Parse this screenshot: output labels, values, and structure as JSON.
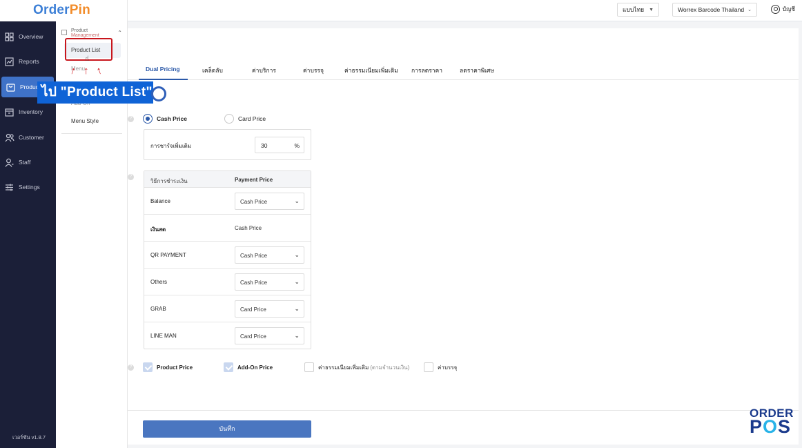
{
  "app": {
    "logo_part1": "Order",
    "logo_part2": "Pin",
    "version": "เวอร์ชัน v1.8.7"
  },
  "header": {
    "language": "แบบไทย",
    "store": "Worrex Barcode Thailand",
    "account": "บัญชี"
  },
  "sidebar": {
    "items": [
      {
        "label": "Overview",
        "icon": "grid-icon"
      },
      {
        "label": "Reports",
        "icon": "chart-icon"
      },
      {
        "label": "Product",
        "icon": "bag-icon",
        "active": true
      },
      {
        "label": "Inventory",
        "icon": "box-icon"
      },
      {
        "label": "Customer",
        "icon": "users-icon"
      },
      {
        "label": "Staff",
        "icon": "person-icon"
      },
      {
        "label": "Settings",
        "icon": "sliders-icon"
      }
    ]
  },
  "submenu": {
    "header_line1": "Product",
    "header_line2": "Management",
    "items": [
      "Product List",
      "Menu",
      "Add-On",
      "Menu Style"
    ]
  },
  "annotation": {
    "callout": "ไป \"Product List\""
  },
  "tabs": [
    "Dual Pricing",
    "เคล็ดลับ",
    "ค่าบริการ",
    "ค่าบรรจุ",
    "ค่าธรรมเนียมเพิ่มเติม",
    "การลดราคา",
    "ลดราคาพิเศษ"
  ],
  "pricing": {
    "option_cash": "Cash Price",
    "option_card": "Card Price",
    "selected": "Cash Price",
    "surcharge_label": "การชาร์จเพิ่มเติม",
    "surcharge_value": "30",
    "surcharge_unit": "%"
  },
  "payment_table": {
    "col_method": "วิธีการชำระเงิน",
    "col_price": "Payment Price",
    "rows": [
      {
        "method": "Balance",
        "price": "Cash Price",
        "dropdown": true
      },
      {
        "method": "เงินสด",
        "price": "Cash Price",
        "dropdown": false
      },
      {
        "method": "QR PAYMENT",
        "price": "Cash Price",
        "dropdown": true
      },
      {
        "method": "Others",
        "price": "Cash Price",
        "dropdown": true
      },
      {
        "method": "GRAB",
        "price": "Card Price",
        "dropdown": true
      },
      {
        "method": "LINE MAN",
        "price": "Card Price",
        "dropdown": true
      }
    ]
  },
  "apply_to": {
    "product_price": "Product Price",
    "addon_price": "Add-On Price",
    "extra_fee": "ค่าธรรมเนียมเพิ่มเติม",
    "extra_fee_note": "(ตามจำนวนเงิน)",
    "packaging": "ค่าบรรจุ"
  },
  "save_label": "บันทึก",
  "watermark": {
    "line1": "ORDER",
    "line2_a": "P",
    "line2_b": "O",
    "line2_c": "S"
  },
  "colors": {
    "sidebar_bg": "#1b1f38",
    "accent": "#3f72c8",
    "tab_active": "#2a58a8",
    "annotation_red": "#c8161d",
    "callout_blue": "#0f63d6"
  }
}
